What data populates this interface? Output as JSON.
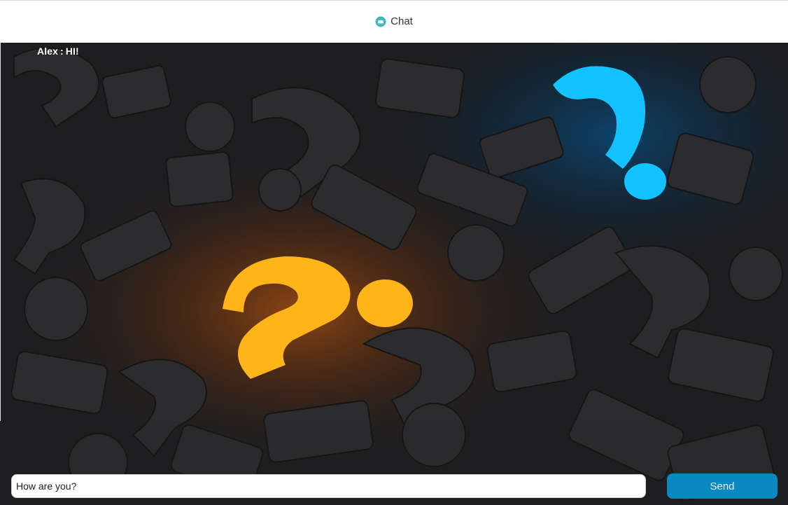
{
  "header": {
    "title": "Chat",
    "icon": "chat-bubble-icon",
    "icon_color": "#3fb8c4"
  },
  "messages": [
    {
      "sender": "Alex",
      "separator": ":",
      "text": "HI!"
    }
  ],
  "composer": {
    "input_value": "How are you?",
    "send_label": "Send",
    "send_color": "#0a88c0"
  },
  "background": {
    "image": "question-marks-background",
    "accent_orange": "#ffb419",
    "accent_blue": "#12c3ff"
  }
}
